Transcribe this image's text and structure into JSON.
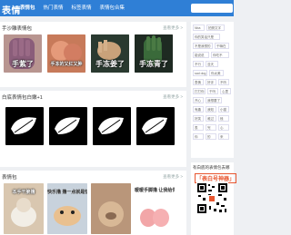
{
  "header": {
    "logo": "表情",
    "nav": [
      "表情包",
      "热门表情",
      "标签表情",
      "表情包合集"
    ]
  },
  "sections": [
    {
      "title": "手沙雕表情包",
      "more": "查看更多 >",
      "items": [
        {
          "caption": "手紫了"
        },
        {
          "caption": "手冻的又红又肿",
          "small": true
        },
        {
          "caption": "手冻姜了"
        },
        {
          "caption": "手冻青了"
        }
      ]
    },
    {
      "title": "白底表情包白嫩+1",
      "more": "查看更多 >",
      "items": [
        {
          "caption": ""
        },
        {
          "caption": ""
        },
        {
          "caption": ""
        },
        {
          "caption": ""
        }
      ]
    },
    {
      "title": "表情包",
      "more": "查看更多 >",
      "items": [
        {
          "caption": "本手干脆撸",
          "small": true
        },
        {
          "caption": "快乐撸 撸一点就是快乐",
          "small": true
        },
        {
          "caption": ""
        },
        {
          "caption": "暖暖手脚撸 让我给你暖暖",
          "small": true
        }
      ]
    }
  ],
  "tags": [
    "Nba",
    "拍照文字",
    "你的笑话只是",
    "不是我想的",
    "干嘛在",
    "能说说",
    "你吃不",
    "不行",
    "没天",
    "sad dog",
    "你太美",
    "表情",
    "好评",
    "不听",
    "打打你",
    "干吗",
    "心里",
    "开心",
    "我想要了",
    "有趣",
    "我知",
    "小猫",
    "好笑",
    "难过",
    "贱",
    "表",
    "完",
    "心",
    "你",
    "的",
    "来"
  ],
  "sidebar": {
    "qr_title": "有白底的表情包去哪",
    "brand": "「表白号神器」"
  },
  "colors": {
    "brand_blue": "#2f7fd6",
    "accent_red": "#e8552e"
  }
}
